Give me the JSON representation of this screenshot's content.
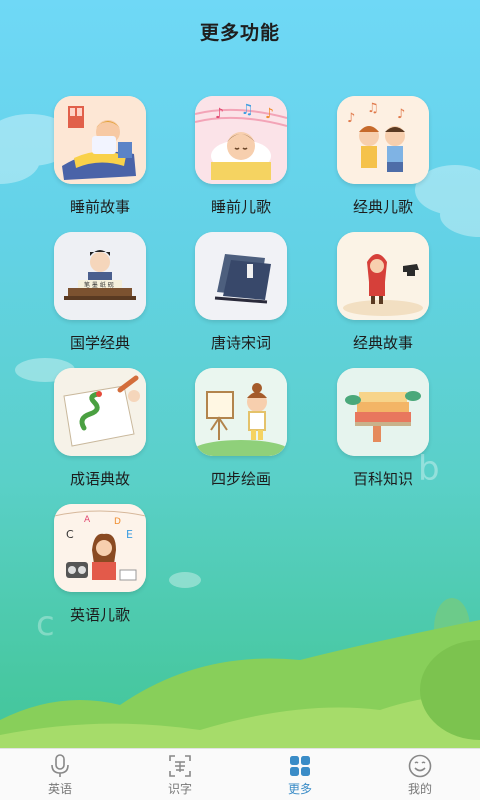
{
  "header": {
    "title": "更多功能"
  },
  "features": [
    {
      "label": "睡前故事",
      "icon": "bedtime-story-icon",
      "bg": "#fde7d5"
    },
    {
      "label": "睡前儿歌",
      "icon": "bedtime-song-icon",
      "bg": "#fbe3e8"
    },
    {
      "label": "经典儿歌",
      "icon": "classic-song-icon",
      "bg": "#fdf0e2"
    },
    {
      "label": "国学经典",
      "icon": "chinese-classics-icon",
      "bg": "#eef0f4"
    },
    {
      "label": "唐诗宋词",
      "icon": "tang-poetry-icon",
      "bg": "#f1f2f6"
    },
    {
      "label": "经典故事",
      "icon": "classic-story-icon",
      "bg": "#fbf3e6"
    },
    {
      "label": "成语典故",
      "icon": "idiom-story-icon",
      "bg": "#f6f2e8"
    },
    {
      "label": "四步绘画",
      "icon": "drawing-icon",
      "bg": "#eaf6ef"
    },
    {
      "label": "百科知识",
      "icon": "encyclopedia-icon",
      "bg": "#e6f4ee"
    },
    {
      "label": "英语儿歌",
      "icon": "english-song-icon",
      "bg": "#fdf3ea"
    }
  ],
  "tabbar": {
    "items": [
      {
        "label": "英语",
        "icon": "microphone-icon",
        "active": false
      },
      {
        "label": "识字",
        "icon": "scan-character-icon",
        "active": false
      },
      {
        "label": "更多",
        "icon": "grid-icon",
        "active": true
      },
      {
        "label": "我的",
        "icon": "smiley-icon",
        "active": false
      }
    ]
  },
  "colors": {
    "active_tab": "#3a8cc7",
    "inactive_tab": "#777777",
    "title": "#1e1e1e"
  }
}
